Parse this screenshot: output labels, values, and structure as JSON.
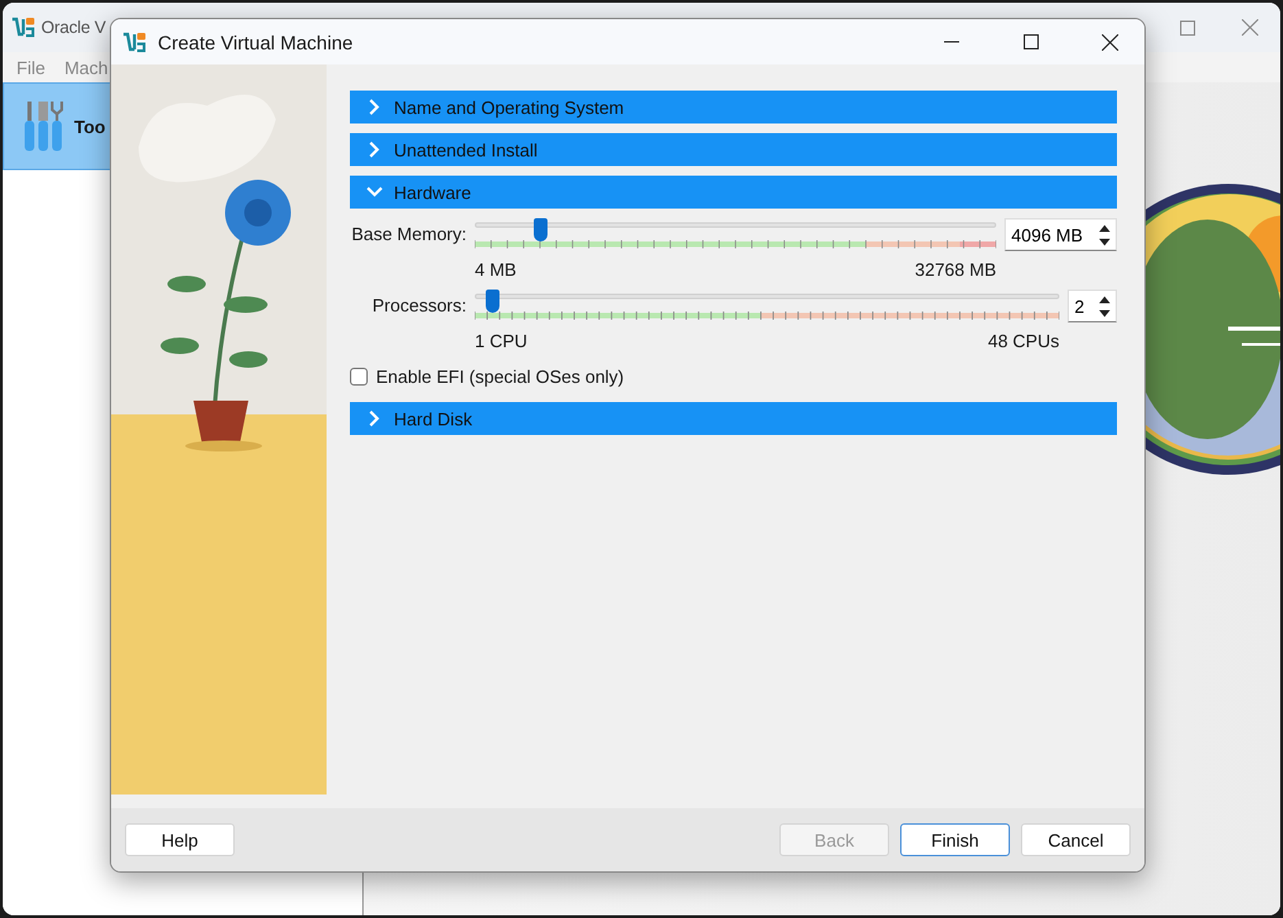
{
  "background_window": {
    "title": "Oracle V",
    "menu": [
      "File",
      "Mach"
    ],
    "tools_item": {
      "label": "Too",
      "selected": true
    }
  },
  "dialog": {
    "title": "Create Virtual Machine",
    "sections": [
      {
        "label": "Name and Operating System",
        "expanded": false
      },
      {
        "label": "Unattended Install",
        "expanded": false
      },
      {
        "label": "Hardware",
        "expanded": true,
        "kind": "hardware",
        "sliders": [
          {
            "label": "Base Memory:",
            "level": 0.125,
            "min": "4 MB",
            "max": "32768 MB",
            "value": "4096 MB"
          },
          {
            "label": "Processors:",
            "level": 0.03,
            "min": "1 CPU",
            "max": "48 CPUs",
            "value": "2"
          }
        ],
        "efi": {
          "label": "Enable EFI (special OSes only)",
          "checked": false
        }
      },
      {
        "label": "Hard Disk",
        "expanded": false
      }
    ],
    "buttons": [
      {
        "label": "Help",
        "disabled": false,
        "default": false
      },
      {
        "label": "Back",
        "disabled": true,
        "default": false
      },
      {
        "label": "Finish",
        "disabled": false,
        "default": true
      },
      {
        "label": "Cancel",
        "disabled": false,
        "default": false
      }
    ]
  }
}
